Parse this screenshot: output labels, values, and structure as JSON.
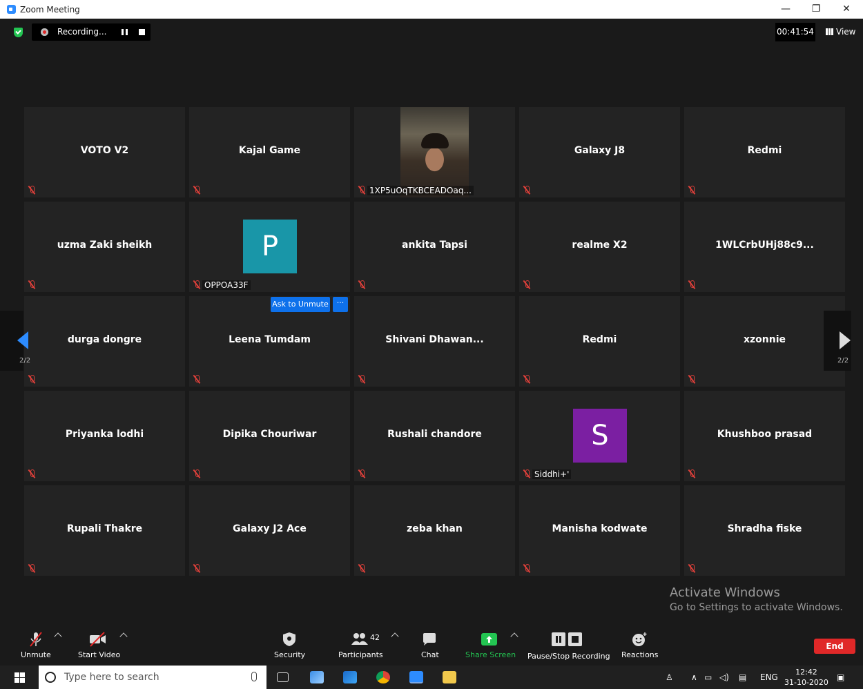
{
  "window": {
    "title": "Zoom Meeting",
    "minimize": "—",
    "restore": "❐",
    "close": "✕"
  },
  "topbar": {
    "recording_label": "Recording...",
    "timer": "00:41:54",
    "view_label": "View"
  },
  "tiles": [
    {
      "name": "VOTO V2"
    },
    {
      "name": "Kajal Game"
    },
    {
      "name": "",
      "label": "1XP5uOqTKBCEADOaq...",
      "video": true
    },
    {
      "name": "Galaxy J8"
    },
    {
      "name": "Redmi"
    },
    {
      "name": "uzma Zaki sheikh"
    },
    {
      "name": "",
      "label": "OPPOA33F",
      "avatar": "P",
      "avatar_color": "#1996a8"
    },
    {
      "name": "ankita Tapsi"
    },
    {
      "name": "realme X2"
    },
    {
      "name": "1WLCrbUHj88c9..."
    },
    {
      "name": "durga dongre"
    },
    {
      "name": "Leena Tumdam"
    },
    {
      "name": "Shivani  Dhawan..."
    },
    {
      "name": "Redmi"
    },
    {
      "name": "xzonnie"
    },
    {
      "name": "Priyanka lodhi"
    },
    {
      "name": "Dipika Chouriwar"
    },
    {
      "name": "Rushali chandore"
    },
    {
      "name": "",
      "label": "Siddhi+'",
      "avatar": "S",
      "avatar_color": "#7b1fa2"
    },
    {
      "name": "Khushboo prasad"
    },
    {
      "name": "Rupali Thakre"
    },
    {
      "name": "Galaxy J2 Ace"
    },
    {
      "name": "zeba khan"
    },
    {
      "name": "Manisha kodwate"
    },
    {
      "name": "Shradha fiske"
    }
  ],
  "hover": {
    "ask_unmute": "Ask to Unmute",
    "more": "···"
  },
  "pagination": {
    "left_page": "2/2",
    "right_page": "2/2"
  },
  "watermark": {
    "line1": "Activate Windows",
    "line2": "Go to Settings to activate Windows."
  },
  "toolbar": {
    "unmute": "Unmute",
    "start_video": "Start Video",
    "security": "Security",
    "participants": "Participants",
    "participant_count": "42",
    "chat": "Chat",
    "share_screen": "Share Screen",
    "pause_stop": "Pause/Stop Recording",
    "reactions": "Reactions",
    "end": "End"
  },
  "taskbar": {
    "search_placeholder": "Type here to search",
    "lang": "ENG",
    "time": "12:42",
    "date": "31-10-2020"
  },
  "colors": {
    "accent": "#0e71eb",
    "share_green": "#23c552",
    "end_red": "#e02828"
  }
}
